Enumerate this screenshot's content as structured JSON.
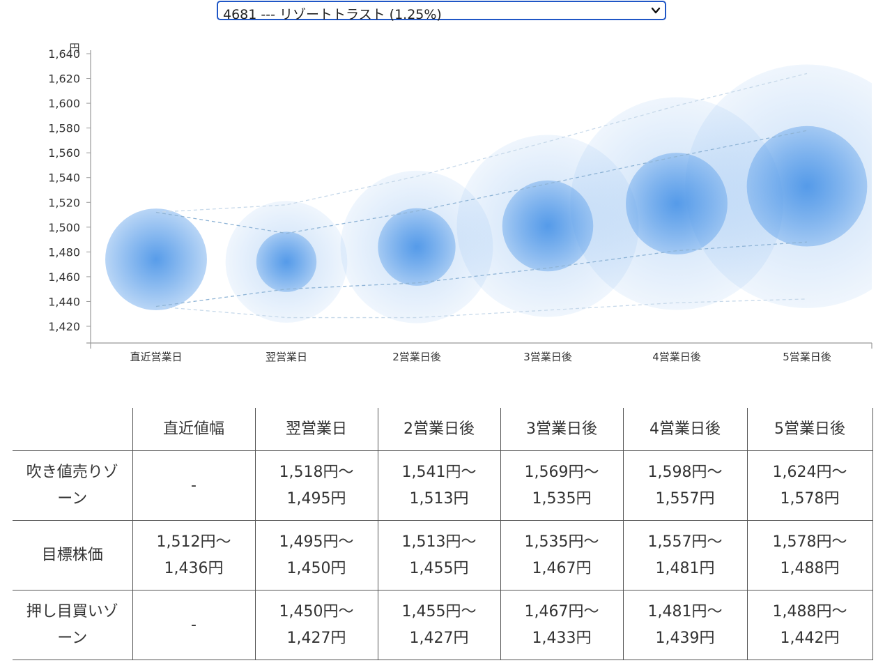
{
  "selector": {
    "selected_label": "4681 --- リゾートトラスト (1.25%)"
  },
  "chart_data": {
    "type": "scatter",
    "y_unit": "円",
    "ylim": [
      1420,
      1640
    ],
    "yticks": [
      1420,
      1440,
      1460,
      1480,
      1500,
      1520,
      1540,
      1560,
      1580,
      1600,
      1620,
      1640
    ],
    "categories": [
      "直近営業日",
      "翌営業日",
      "2営業日後",
      "3営業日後",
      "4営業日後",
      "5営業日後"
    ],
    "center": [
      1474,
      1472,
      1484,
      1501,
      1519,
      1533
    ],
    "inner_band": {
      "upper": [
        1512,
        1495,
        1513,
        1535,
        1557,
        1578
      ],
      "lower": [
        1436,
        1450,
        1455,
        1467,
        1481,
        1488
      ]
    },
    "outer_band": {
      "upper": [
        1512,
        1518,
        1541,
        1569,
        1598,
        1624
      ],
      "lower": [
        1436,
        1427,
        1427,
        1433,
        1439,
        1442
      ]
    },
    "grid": false,
    "legend": "none",
    "colors": {
      "bubble": "#4f97e8",
      "dashed_line": "#8fb4d6",
      "axis": "#999999"
    }
  },
  "table": {
    "headers": [
      "",
      "直近値幅",
      "翌営業日",
      "2営業日後",
      "3営業日後",
      "4営業日後",
      "5営業日後"
    ],
    "rows": [
      {
        "label": [
          "吹き値売りゾ",
          "ーン"
        ],
        "cells": [
          [
            "-"
          ],
          [
            "1,518円〜",
            "1,495円"
          ],
          [
            "1,541円〜",
            "1,513円"
          ],
          [
            "1,569円〜",
            "1,535円"
          ],
          [
            "1,598円〜",
            "1,557円"
          ],
          [
            "1,624円〜",
            "1,578円"
          ]
        ]
      },
      {
        "label": [
          "目標株価"
        ],
        "cells": [
          [
            "1,512円〜",
            "1,436円"
          ],
          [
            "1,495円〜",
            "1,450円"
          ],
          [
            "1,513円〜",
            "1,455円"
          ],
          [
            "1,535円〜",
            "1,467円"
          ],
          [
            "1,557円〜",
            "1,481円"
          ],
          [
            "1,578円〜",
            "1,488円"
          ]
        ]
      },
      {
        "label": [
          "押し目買いゾ",
          "ーン"
        ],
        "cells": [
          [
            "-"
          ],
          [
            "1,450円〜",
            "1,427円"
          ],
          [
            "1,455円〜",
            "1,427円"
          ],
          [
            "1,467円〜",
            "1,433円"
          ],
          [
            "1,481円〜",
            "1,439円"
          ],
          [
            "1,488円〜",
            "1,442円"
          ]
        ]
      }
    ]
  }
}
